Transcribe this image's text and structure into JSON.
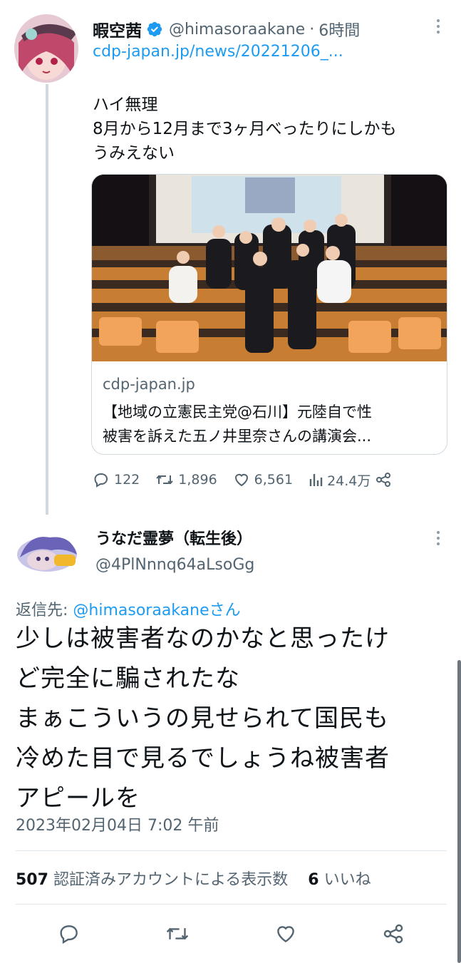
{
  "parent": {
    "name": "暇空茜",
    "handle": "@himasoraakane",
    "dot": "·",
    "time": "6時間",
    "link": "cdp-japan.jp/news/20221206_...",
    "text_lines": [
      "ハイ無理",
      "8月から12月まで3ヶ月べったりにしかも",
      "うみえない"
    ],
    "card": {
      "domain": "cdp-japan.jp",
      "title_lines": [
        "【地域の立憲民主党@石川】元陸自で性",
        "被害を訴えた五ノ井里奈さんの講演会..."
      ]
    },
    "actions": {
      "replies": "122",
      "retweets": "1,896",
      "likes": "6,561",
      "views": "24.4万"
    }
  },
  "reply": {
    "name": "うなだ霊夢（転生後）",
    "handle": "@4PlNnnq64aLsoGg",
    "reply_to_prefix": "返信先: ",
    "reply_to_mention": "@himasoraakane",
    "reply_to_suffix": "さん",
    "text_lines": [
      "少しは被害者なのかなと思ったけ",
      "ど完全に騙されたな",
      "まぁこういうの見せられて国民も",
      "冷めた目で見るでしょうね被害者",
      "アピールを"
    ],
    "date": "2023年02月04日 7:02 午前",
    "views_count": "507",
    "views_label": "認証済みアカウントによる表示数",
    "likes_count": "6",
    "likes_label": "いいね"
  },
  "colors": {
    "accent": "#1d9bf0",
    "muted": "#536471",
    "text": "#0f1419"
  }
}
